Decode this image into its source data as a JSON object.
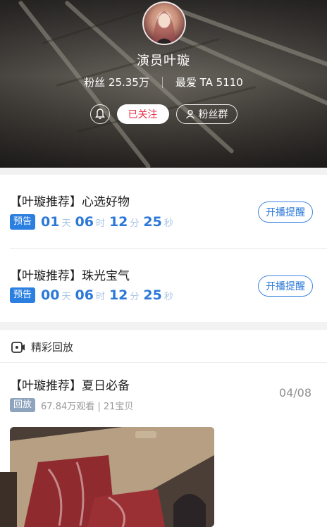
{
  "host": {
    "name": "演员叶璇",
    "fans": "粉丝 25.35万",
    "love": "最爱 TA 5110",
    "follow_label": "已关注",
    "fans_group_label": "粉丝群"
  },
  "upcoming": [
    {
      "title": "【叶璇推荐】心选好物",
      "tag": "预告",
      "countdown": {
        "d": "01",
        "d_unit": "天",
        "h": "06",
        "h_unit": "时",
        "m": "12",
        "m_unit": "分",
        "s": "25",
        "s_unit": "秒"
      },
      "remind_label": "开播提醒"
    },
    {
      "title": "【叶璇推荐】珠光宝气",
      "tag": "预告",
      "countdown": {
        "d": "00",
        "d_unit": "天",
        "h": "06",
        "h_unit": "时",
        "m": "12",
        "m_unit": "分",
        "s": "25",
        "s_unit": "秒"
      },
      "remind_label": "开播提醒"
    }
  ],
  "replay_section": {
    "title": "精彩回放",
    "item": {
      "title": "【叶璇推荐】夏日必备",
      "tag": "回放",
      "meta": "67.84万观看 | 21宝贝",
      "date": "04/08"
    }
  },
  "colors": {
    "accent_blue": "#2b78d8",
    "follow_red": "#e8334a",
    "replay_tag": "#8ea3bd"
  },
  "icons": [
    "bell-icon",
    "people-icon",
    "video-replay-icon"
  ]
}
